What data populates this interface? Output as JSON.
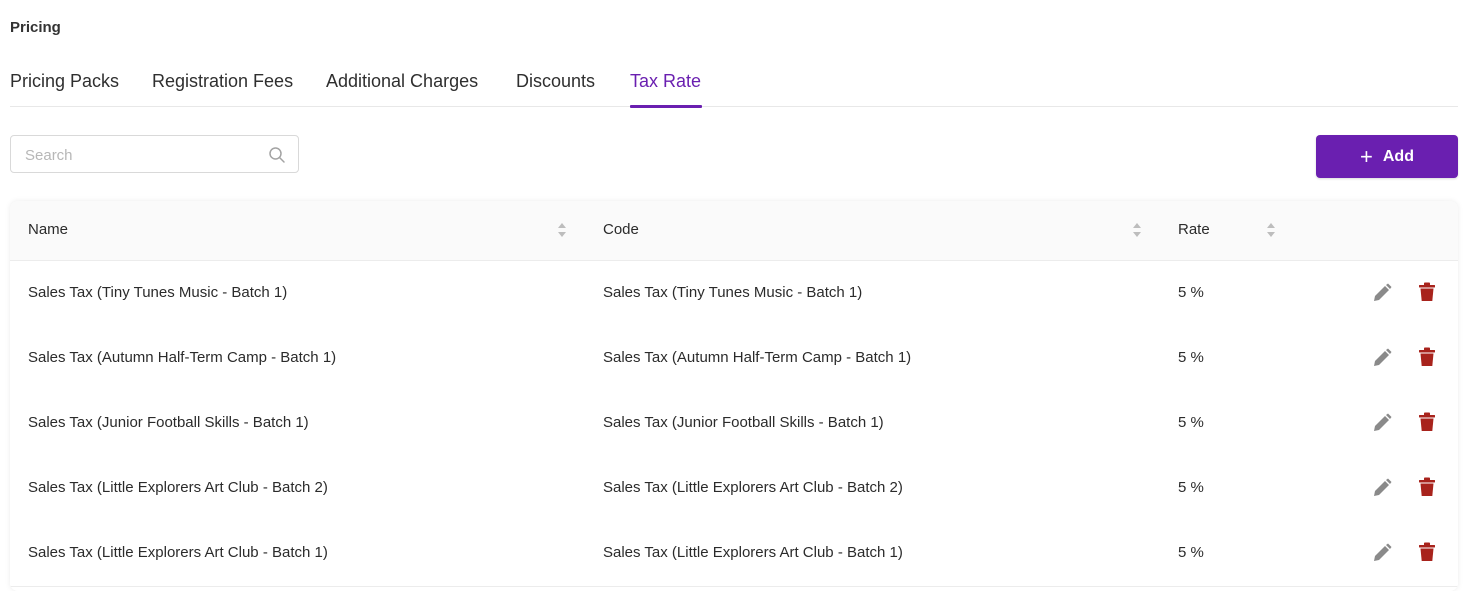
{
  "page": {
    "title": "Pricing"
  },
  "tabs": [
    {
      "label": "Pricing Packs"
    },
    {
      "label": "Registration Fees"
    },
    {
      "label": "Additional Charges"
    },
    {
      "label": "Discounts"
    },
    {
      "label": "Tax Rate",
      "active": true
    }
  ],
  "search": {
    "placeholder": "Search",
    "value": "",
    "icon": "search-icon"
  },
  "toolbar": {
    "add_label": "Add",
    "add_icon": "plus-icon"
  },
  "colors": {
    "accent": "#6a1fb0",
    "delete": "#a8231c",
    "edit": "#8a8a8a"
  },
  "table": {
    "columns": [
      {
        "label": "Name",
        "sortable": true
      },
      {
        "label": "Code",
        "sortable": true
      },
      {
        "label": "Rate",
        "sortable": true
      }
    ],
    "rows": [
      {
        "name": "Sales Tax (Tiny Tunes Music - Batch 1)",
        "code": "Sales Tax (Tiny Tunes Music - Batch 1)",
        "rate": "5 %"
      },
      {
        "name": "Sales Tax (Autumn Half-Term Camp - Batch 1)",
        "code": "Sales Tax (Autumn Half-Term Camp - Batch 1)",
        "rate": "5 %"
      },
      {
        "name": "Sales Tax (Junior Football Skills - Batch 1)",
        "code": "Sales Tax (Junior Football Skills - Batch 1)",
        "rate": "5 %"
      },
      {
        "name": "Sales Tax (Little Explorers Art Club - Batch 2)",
        "code": "Sales Tax (Little Explorers Art Club - Batch 2)",
        "rate": "5 %"
      },
      {
        "name": "Sales Tax (Little Explorers Art Club - Batch 1)",
        "code": "Sales Tax (Little Explorers Art Club - Batch 1)",
        "rate": "5 %"
      }
    ],
    "row_actions": [
      "edit-icon",
      "delete-icon"
    ]
  }
}
